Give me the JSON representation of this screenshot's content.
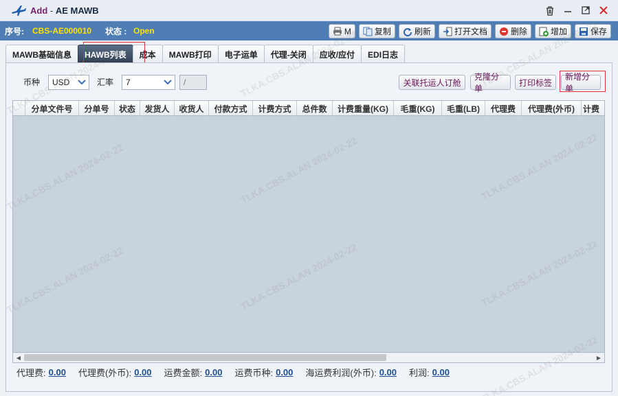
{
  "window": {
    "prefix": "Add",
    "separator": " - ",
    "title": "AE MAWB"
  },
  "status": {
    "serial_label": "序号:",
    "serial_value": "CBS-AE000010",
    "state_label": "状态 :",
    "state_value": "Open"
  },
  "toolbar": {
    "m_label": "M",
    "copy_label": "复制",
    "refresh_label": "刷新",
    "open_doc_label": "打开文档",
    "delete_label": "删除",
    "add_label": "增加",
    "save_label": "保存"
  },
  "tabs": [
    {
      "label": "MAWB基础信息"
    },
    {
      "label": "HAWB列表"
    },
    {
      "label": "成本"
    },
    {
      "label": "MAWB打印"
    },
    {
      "label": "电子运单"
    },
    {
      "label": "代理-关闭"
    },
    {
      "label": "应收/应付"
    },
    {
      "label": "EDI日志"
    }
  ],
  "filters": {
    "currency_label": "币种",
    "currency_value": "USD",
    "rate_label": "汇率",
    "rate_value": "7",
    "rate_extra": "/"
  },
  "actions": {
    "link_booking": "关联托运人订舱",
    "clone_hawb": "克隆分单",
    "print_label": "打印标签",
    "new_hawb": "新增分单"
  },
  "columns": [
    "分单文件号",
    "分单号",
    "状态",
    "发货人",
    "收货人",
    "付款方式",
    "计费方式",
    "总件数",
    "计费重量(KG)",
    "毛重(KG)",
    "毛重(LB)",
    "代理费",
    "代理费(外币)",
    "计费"
  ],
  "footer": {
    "agent_fee_label": "代理费:",
    "agent_fee_value": "0.00",
    "agent_fee_fc_label": "代理费(外币):",
    "agent_fee_fc_value": "0.00",
    "freight_amount_label": "运费金额:",
    "freight_amount_value": "0.00",
    "freight_currency_label": "运费币种:",
    "freight_currency_value": "0.00",
    "ocean_profit_label": "海运费利润(外币):",
    "ocean_profit_value": "0.00",
    "profit_label": "利润:",
    "profit_value": "0.00"
  },
  "watermark": "TLKA.CBS.ALAN 2024-02-22",
  "icons": {
    "app": "airplane-icon",
    "trash": "trash-icon",
    "minimize": "minimize-icon",
    "maximize": "maximize-icon",
    "close": "close-icon"
  },
  "colors": {
    "status_bar": "#4e7eb3",
    "status_value": "#ffe200",
    "active_tab": "#2f3e52",
    "action_text": "#6b1457",
    "highlight": "#e03333"
  }
}
